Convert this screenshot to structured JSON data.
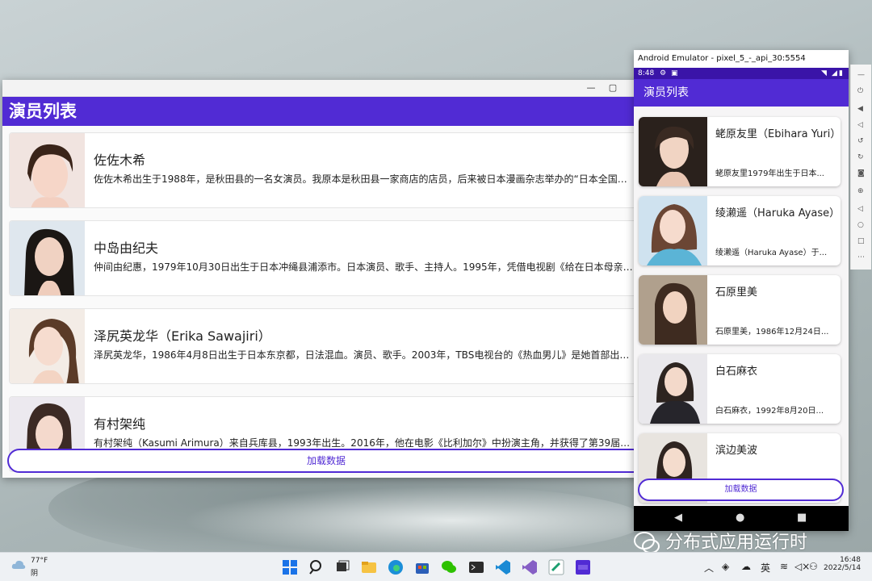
{
  "desktop": {
    "app_title": "演员列表",
    "actors": [
      {
        "name": "佐佐木希",
        "desc": "佐佐木希出生于1988年，是秋田县的一名女演员。我原本是秋田县一家商店的店员，后来被日本漫画杂志举办的“日本全国寻..."
      },
      {
        "name": "中岛由纪夫",
        "desc": "仲间由纪惠，1979年10月30日出生于日本冲绳县浦添市。日本演员、歌手、主持人。1995年，凭借电视剧《给在日本母亲的..."
      },
      {
        "name": "泽尻英龙华（Erika Sawajiri）",
        "desc": "泽尻英龙华，1986年4月8日出生于日本东京都，日法混血。演员、歌手。2003年，TBS电视台的《热血男儿》是她首部出演..."
      },
      {
        "name": "有村架纯",
        "desc": "有村架纯（Kasumi Arimura）来自兵库县，1993年出生。2016年，他在电影《比利加尔》中扮演主角，并获得了第39届日..."
      }
    ],
    "load_button": "加载数据"
  },
  "emulator": {
    "window_title": "Android Emulator - pixel_5_-_api_30:5554",
    "status_time": "8:48",
    "app_title": "演员列表",
    "actors": [
      {
        "name": "蛯原友里（Ebihara Yuri）",
        "desc": "蛯原友里1979年出生于日本..."
      },
      {
        "name": "绫濑遥（Haruka Ayase）",
        "desc": "绫濑遥（Haruka Ayase）于..."
      },
      {
        "name": "石原里美",
        "desc": "石原里美，1986年12月24日..."
      },
      {
        "name": "白石麻衣",
        "desc": "白石麻衣，1992年8月20日..."
      },
      {
        "name": "滨边美波",
        "desc": ""
      }
    ],
    "load_button": "加载数据"
  },
  "watermark": "分布式应用运行时",
  "taskbar": {
    "weather_temp": "77°F",
    "weather_cond": "阴",
    "ime": "英",
    "time": "16:48",
    "date": "2022/5/14"
  },
  "colors": {
    "accent": "#512bd4"
  }
}
